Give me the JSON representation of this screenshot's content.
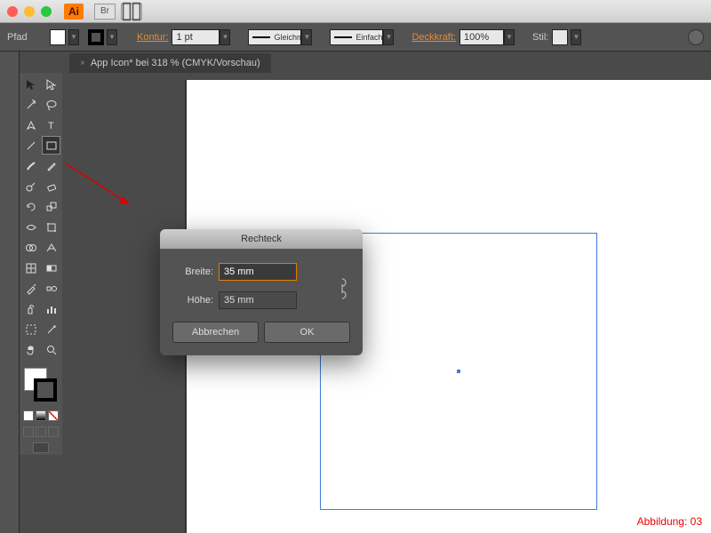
{
  "title_bar": {
    "app_badge": "Ai",
    "bridge_label": "Br"
  },
  "control_bar": {
    "path_label": "Pfad",
    "kontur_label": "Kontur:",
    "stroke_value": "1 pt",
    "stroke_type1": "Gleichm.",
    "stroke_type2": "Einfach",
    "opacity_label": "Deckkraft:",
    "opacity_value": "100%",
    "stil_label": "Stil:"
  },
  "tab": {
    "title": "App Icon* bei 318 % (CMYK/Vorschau)",
    "close": "×"
  },
  "dialog": {
    "title": "Rechteck",
    "width_label": "Breite:",
    "width_value": "35 mm",
    "height_label": "Höhe:",
    "height_value": "35 mm",
    "cancel": "Abbrechen",
    "ok": "OK"
  },
  "caption": "Abbildung: 03",
  "colors": {
    "accent": "#ff7b00",
    "selection": "#3b7dd8",
    "annotation": "#d00"
  }
}
